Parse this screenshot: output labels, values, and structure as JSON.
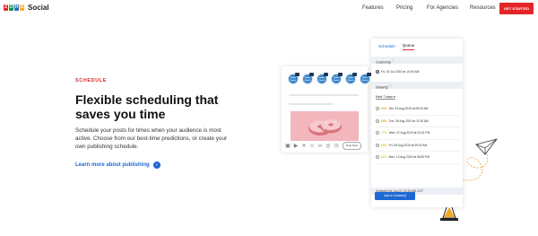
{
  "nav": {
    "brand": "Social",
    "links": [
      "Features",
      "Pricing",
      "For Agencies",
      "Resources"
    ],
    "cta": "GET STARTED"
  },
  "hero": {
    "eyebrow": "SCHEDULE",
    "headline": "Flexible scheduling that saves you time",
    "description": "Schedule your posts for times when your audience is most active. Choose from our best-time predictions, or create your own publishing schedule.",
    "learn_more": "Learn more about publishing"
  },
  "composer": {
    "avatar_labels": [
      "Zylker Travels",
      "Zylker Travels",
      "Zylker Travels",
      "Zylker Travels",
      "Zylker Travels",
      "Zylker Travels"
    ],
    "post_button": "Post Now"
  },
  "schedule_panel": {
    "tabs": [
      "Schedule",
      "Queue"
    ],
    "active_tab": "Queue",
    "custom_q_label": "CustomQ",
    "custom_q_slot": "Fri, 02 Jul 2019 at 10:00 AM",
    "smart_q_label": "SmartQ",
    "range": "Next 7 days",
    "slots": [
      {
        "pct": "93%",
        "text": "Sat, 03 Aug 2019 at 08:00 AM",
        "color": "#e8a33b"
      },
      {
        "pct": "85%",
        "text": "Tue, 06 Aug 2019 at 11:30 AM",
        "color": "#e8a33b"
      },
      {
        "pct": "77%",
        "text": "Wed, 07 Aug 2019 at 03:21 PM",
        "color": "#e8c33b"
      },
      {
        "pct": "65%",
        "text": "Fri, 09 Aug 2019 at 09:02 AM",
        "color": "#e8c33b"
      },
      {
        "pct": "61%",
        "text": "Mon, 12 Aug 2019 at 05:50 PM",
        "color": "#e8c33b"
      }
    ],
    "schedule_for": "Schedule for Jun 03, 02:00 AM CDT",
    "add_button": "Add to CustomQ"
  },
  "colors": {
    "accent_red": "#e42527",
    "link_blue": "#1e68d4",
    "donut_bg": "#f3b6bd"
  }
}
